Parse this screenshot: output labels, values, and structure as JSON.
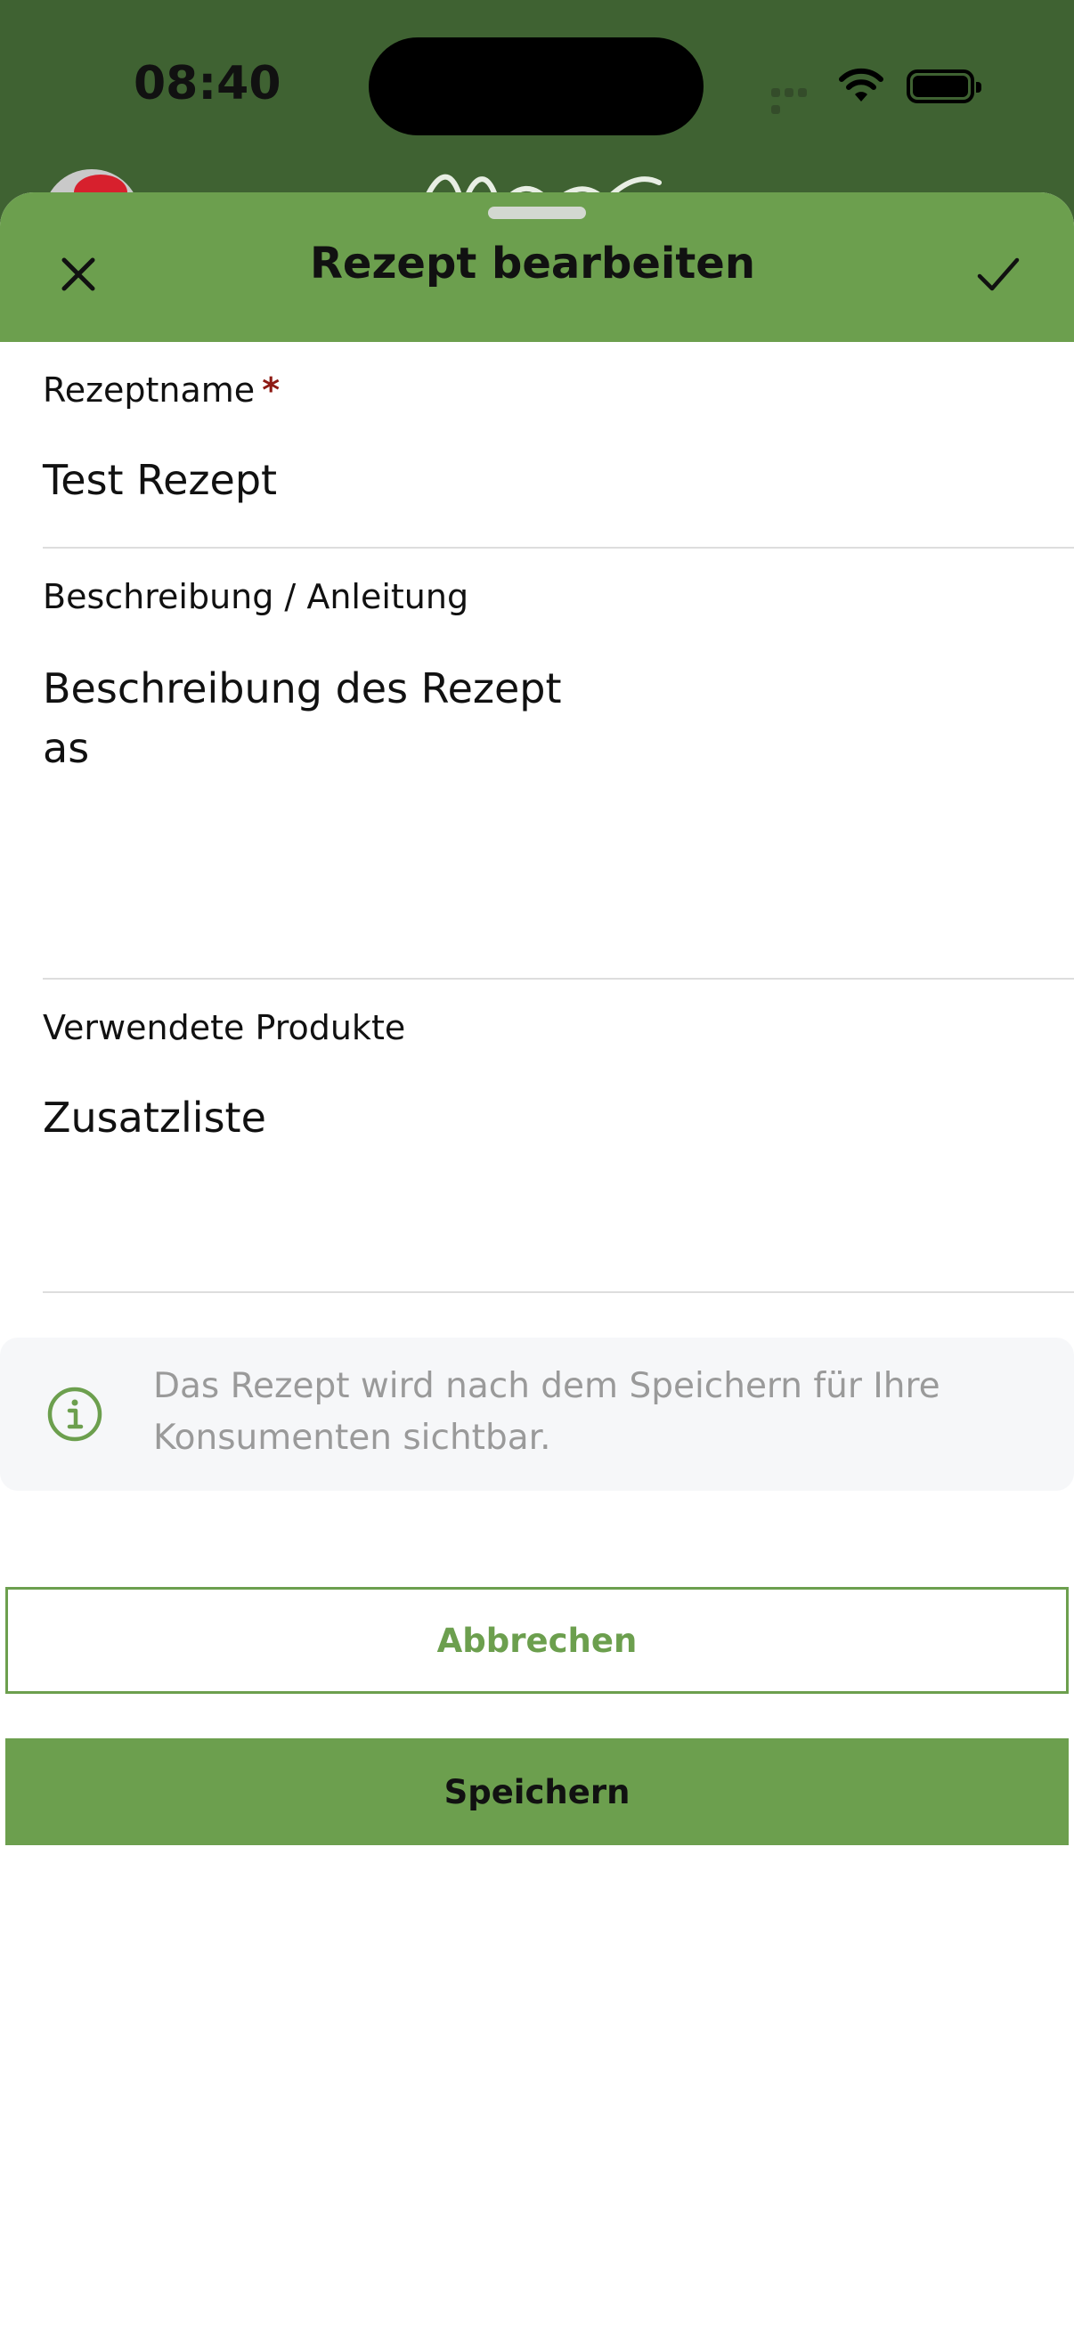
{
  "status_bar": {
    "time": "08:40"
  },
  "colors": {
    "brand_green": "#6c9f4e",
    "backdrop_green": "#3f6232",
    "required_star": "#8e1a14",
    "info_bg": "#f6f7f9"
  },
  "sheet": {
    "title": "Rezept bearbeiten",
    "close_icon": "close-icon",
    "confirm_icon": "checkmark-icon"
  },
  "form": {
    "name_label": "Rezeptname",
    "required_mark": "*",
    "name_value": "Test Rezept",
    "description_label": "Beschreibung / Anleitung",
    "description_value": "Beschreibung des Rezept\nas",
    "products_label": "Verwendete Produkte",
    "products_value": "Zusatzliste"
  },
  "info": {
    "icon": "info-icon",
    "text": "Das Rezept wird nach dem Speichern für Ihre Konsumenten sichtbar."
  },
  "buttons": {
    "cancel_label": "Abbrechen",
    "save_label": "Speichern"
  }
}
